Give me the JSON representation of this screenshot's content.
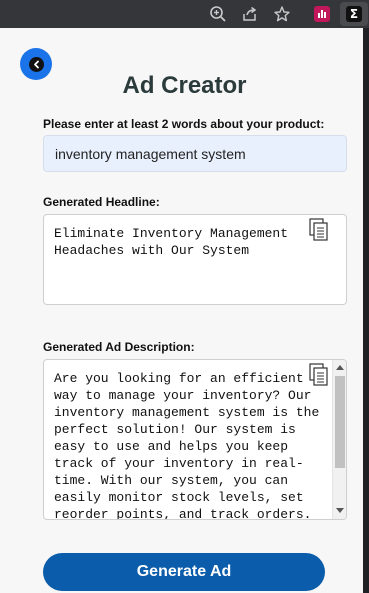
{
  "browser_toolbar": {
    "icons": [
      "zoom-icon",
      "share-icon",
      "bookmark-star-icon",
      "extension-analytics-icon",
      "extension-sigma-icon"
    ],
    "extension_sigma_glyph": "Σ",
    "extension_analytics_color": "#c2185b"
  },
  "popup": {
    "title": "Ad Creator",
    "product_prompt_label": "Please enter at least 2 words about your product:",
    "product_input_value": "inventory management system",
    "headline_label": "Generated Headline:",
    "headline_text": "Eliminate Inventory Management Headaches with Our System",
    "description_label": "Generated Ad Description:",
    "description_text": "Are you looking for an efficient way to manage your inventory? Our inventory management system is the perfect solution! Our system is easy to use and helps you keep track of your inventory in real-time. With our system, you can easily monitor stock levels, set reorder points, and track orders.",
    "generate_button_label": "Generate Ad"
  },
  "colors": {
    "accent_blue": "#1a73e8",
    "button_blue": "#0b5cab",
    "input_bg": "#e8f0fe",
    "title_color": "#2b3a3a"
  }
}
